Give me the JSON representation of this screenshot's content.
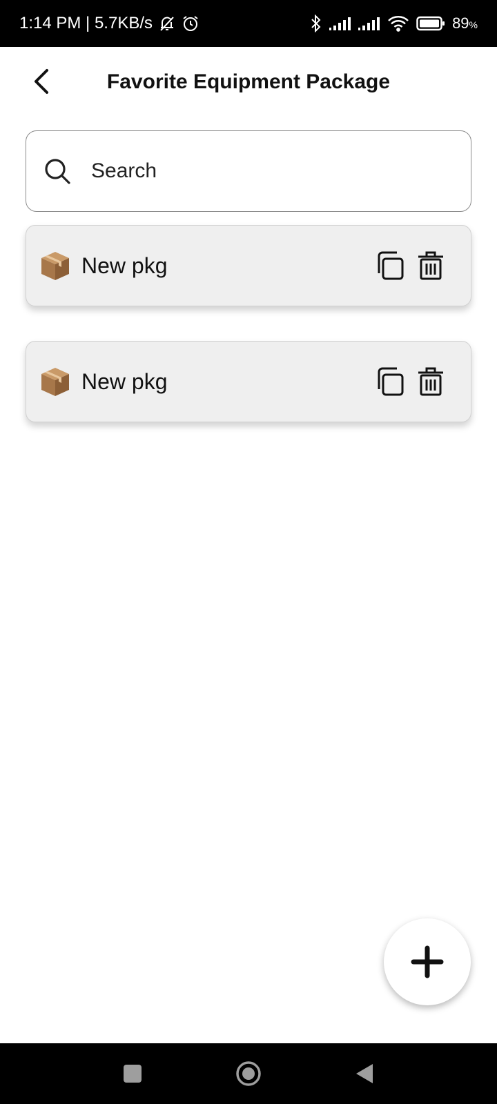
{
  "status_bar": {
    "time_speed": "1:14 PM | 5.7KB/s",
    "battery_level": "89",
    "battery_unit": "%",
    "icons": [
      "mute-bell-icon",
      "alarm-icon",
      "bluetooth-icon",
      "signal-icon",
      "signal-icon",
      "wifi-icon",
      "battery-icon"
    ]
  },
  "header": {
    "title": "Favorite Equipment Package",
    "back_icon": "chevron-left-icon"
  },
  "search": {
    "placeholder": "Search",
    "icon": "search-icon"
  },
  "packages": [
    {
      "name": "New pkg",
      "icon": "package-icon",
      "actions": [
        "copy-icon",
        "trash-icon"
      ]
    },
    {
      "name": "New pkg",
      "icon": "package-icon",
      "actions": [
        "copy-icon",
        "trash-icon"
      ]
    }
  ],
  "fab": {
    "icon": "plus-icon"
  },
  "nav_bar": {
    "icons": [
      "recent-apps-icon",
      "home-icon",
      "back-icon"
    ]
  }
}
